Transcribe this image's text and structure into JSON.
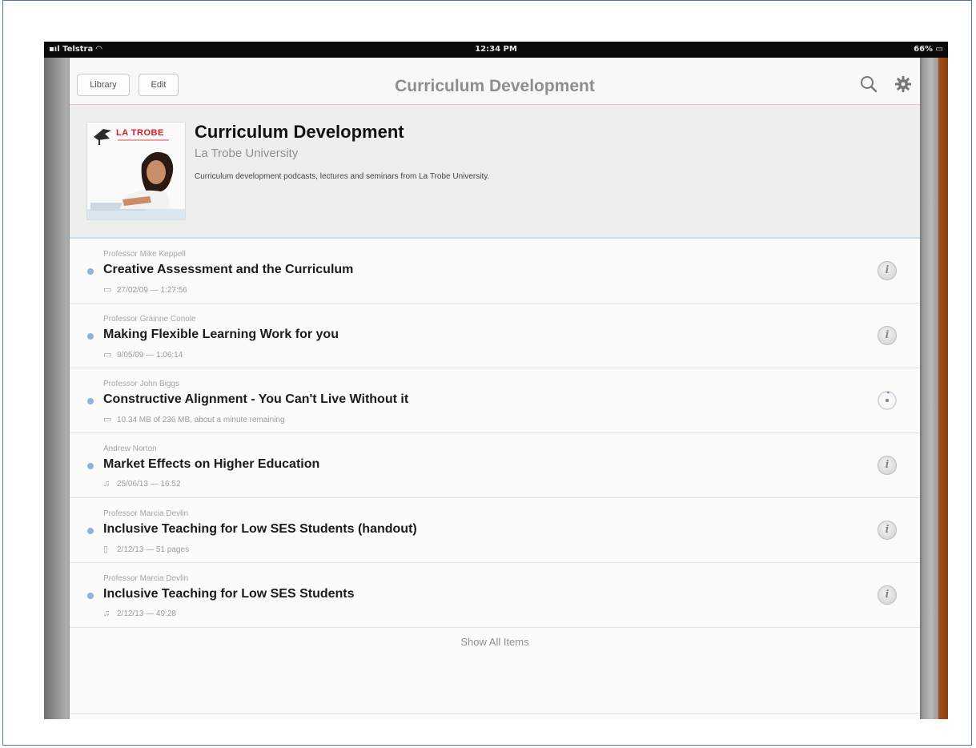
{
  "status_bar": {
    "carrier": "Telstra",
    "time": "12:34 PM",
    "battery": "66%"
  },
  "nav": {
    "library_label": "Library",
    "edit_label": "Edit",
    "title": "Curriculum Development",
    "search_icon": "search-icon",
    "settings_icon": "gear-icon"
  },
  "podcast": {
    "logo_text": "LA TROBE",
    "title": "Curriculum Development",
    "author": "La Trobe University",
    "description": "Curriculum development podcasts, lectures and seminars from La Trobe University."
  },
  "episodes": [
    {
      "author": "Professor Mike Keppell",
      "title": "Creative Assessment and the Curriculum",
      "meta": "27/02/09 — 1:27:56",
      "media": "video-icon",
      "status": "info"
    },
    {
      "author": "Professor Gráinne Conole",
      "title": "Making Flexible Learning Work for you",
      "meta": "9/05/09 — 1:06:14",
      "media": "video-icon",
      "status": "info"
    },
    {
      "author": "Professor John Biggs",
      "title": "Constructive Alignment - You Can't Live Without it",
      "meta": "10.34 MB of 236 MB, about a minute remaining",
      "media": "video-icon",
      "status": "downloading"
    },
    {
      "author": "Andrew Norton",
      "title": "Market Effects on Higher Education",
      "meta": "25/06/13 — 16:52",
      "media": "audio-icon",
      "status": "info"
    },
    {
      "author": "Professor Marcia Devlin",
      "title": "Inclusive Teaching for Low SES Students (handout)",
      "meta": "2/12/13 — 51 pages",
      "media": "document-icon",
      "status": "info"
    },
    {
      "author": "Professor Marcia Devlin",
      "title": "Inclusive Teaching for Low SES Students",
      "meta": "2/12/13 — 49:28",
      "media": "audio-icon",
      "status": "info"
    }
  ],
  "show_all_label": "Show All Items",
  "colors": {
    "unplayed_dot": "#8fb1de",
    "logo_red": "#d21f26"
  }
}
